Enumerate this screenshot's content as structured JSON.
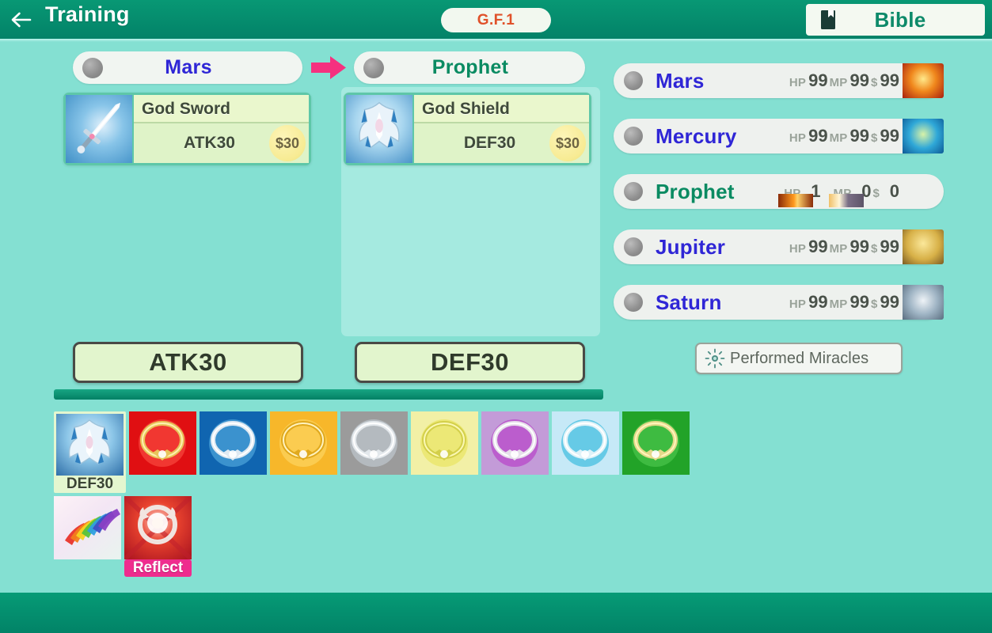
{
  "topbar": {
    "back_icon": "arrow-left-icon",
    "title": "Training",
    "gf_badge": "G.F.1",
    "bible_icon": "book-icon",
    "bible_label": "Bible"
  },
  "transfer": {
    "from": {
      "name": "Mars",
      "name_color": "#2f26d6"
    },
    "to": {
      "name": "Prophet",
      "name_color": "#0a8b62"
    },
    "arrow_icon": "arrow-right-icon",
    "arrow_color": "#f5317f",
    "from_item": {
      "icon": "god-sword-icon",
      "name": "God Sword",
      "stat": "ATK30",
      "price": "$30"
    },
    "to_item": {
      "icon": "god-shield-icon",
      "name": "God Shield",
      "stat": "DEF30",
      "price": "$30"
    }
  },
  "totals": {
    "atk": "ATK30",
    "def": "DEF30"
  },
  "inventory": {
    "rows": [
      [
        {
          "icon": "god-shield-icon",
          "label": "DEF30",
          "selected": true,
          "bg": "#2f6fa8"
        },
        {
          "icon": "ring-red-icon",
          "label": "",
          "selected": false,
          "bg": "#e00f12"
        },
        {
          "icon": "ring-blue-icon",
          "label": "",
          "selected": false,
          "bg": "#1065b0"
        },
        {
          "icon": "ring-gold-icon",
          "label": "",
          "selected": false,
          "bg": "#f7b72a"
        },
        {
          "icon": "ring-silver-icon",
          "label": "",
          "selected": false,
          "bg": "#9b9b9b"
        },
        {
          "icon": "ring-yellow-icon",
          "label": "",
          "selected": false,
          "bg": "#f2f0a6"
        },
        {
          "icon": "ring-purple-icon",
          "label": "",
          "selected": false,
          "bg": "#c39bd8"
        },
        {
          "icon": "ring-cyan-icon",
          "label": "",
          "selected": false,
          "bg": "#c6e9f7"
        },
        {
          "icon": "ring-green-icon",
          "label": "",
          "selected": false,
          "bg": "#22a328"
        }
      ],
      [
        {
          "icon": "rainbow-wing-icon",
          "label": "",
          "selected": false,
          "bg": "#f6e8f0"
        },
        {
          "icon": "reflect-icon",
          "label": "Reflect",
          "selected": false,
          "bg": "#c1182a",
          "label_style": "pink"
        }
      ]
    ]
  },
  "characters": {
    "stat_keys": {
      "hp": "HP",
      "mp": "MP",
      "money": "$"
    },
    "rows": [
      {
        "name": "Mars",
        "name_color": "#2f26d6",
        "hp": "99",
        "mp": "99",
        "money": "99",
        "portrait": "mars-portrait",
        "has_bars": false
      },
      {
        "name": "Mercury",
        "name_color": "#2f26d6",
        "hp": "99",
        "mp": "99",
        "money": "99",
        "portrait": "mercury-portrait",
        "has_bars": false
      },
      {
        "name": "Prophet",
        "name_color": "#0a8b62",
        "hp": "1",
        "mp": "0",
        "money": "0",
        "portrait": "prophet-portrait",
        "has_bars": true
      },
      {
        "name": "Jupiter",
        "name_color": "#2f26d6",
        "hp": "99",
        "mp": "99",
        "money": "99",
        "portrait": "jupiter-portrait",
        "has_bars": false
      },
      {
        "name": "Saturn",
        "name_color": "#2f26d6",
        "hp": "99",
        "mp": "99",
        "money": "99",
        "portrait": "saturn-portrait",
        "has_bars": false
      }
    ]
  },
  "miracles": {
    "icon": "sparkle-icon",
    "label": "Performed Miracles"
  }
}
